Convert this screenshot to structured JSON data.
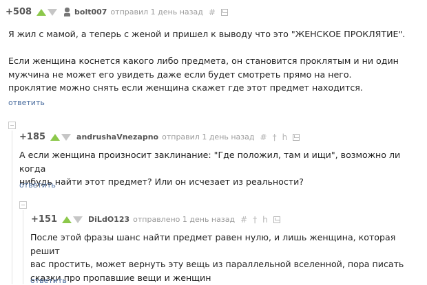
{
  "comments": [
    {
      "rating": "+508",
      "author": "bolt007",
      "meta": "отправил 1 день назад",
      "lines": [
        "Я жил с мамой, а теперь с женой и пришел к выводу что это \"ЖЕНСКОЕ ПРОКЛЯТИЕ\".",
        "",
        "Если женщина коснется какого либо предмета, он становится проклятым и ни один",
        "мужчина не может его увидеть даже если будет смотреть прямо на него.",
        "проклятие можно снять если женщина скажет где этот предмет находится."
      ],
      "reply_label": "ответить"
    },
    {
      "rating": "+185",
      "author": "andrushaVnezapno",
      "meta": "отправил 1 день назад",
      "lines": [
        "А если женщина произносит заклинание: \"Где положил, там и ищи\", возможно ли когда",
        "нибудь найти этот предмет? Или он исчезает из реальности?"
      ],
      "reply_label": "ответить"
    },
    {
      "rating": "+151",
      "author": "DiLdO123",
      "meta": "отправлено 1 день назад",
      "lines": [
        "После этой фразы шанс найти предмет равен нулю, и лишь женщина, которая решит",
        "вас простить, может вернуть эту вещь из параллельной вселенной, пора писать",
        "сказки про пропавшие вещи и женщин"
      ],
      "reply_label": "ответить"
    }
  ],
  "icons": {
    "hash": "#",
    "pin": "†",
    "reply_to": "h"
  },
  "colors": {
    "upvote": "#8cc84b",
    "link": "#4d6fa0",
    "muted": "#999999"
  }
}
